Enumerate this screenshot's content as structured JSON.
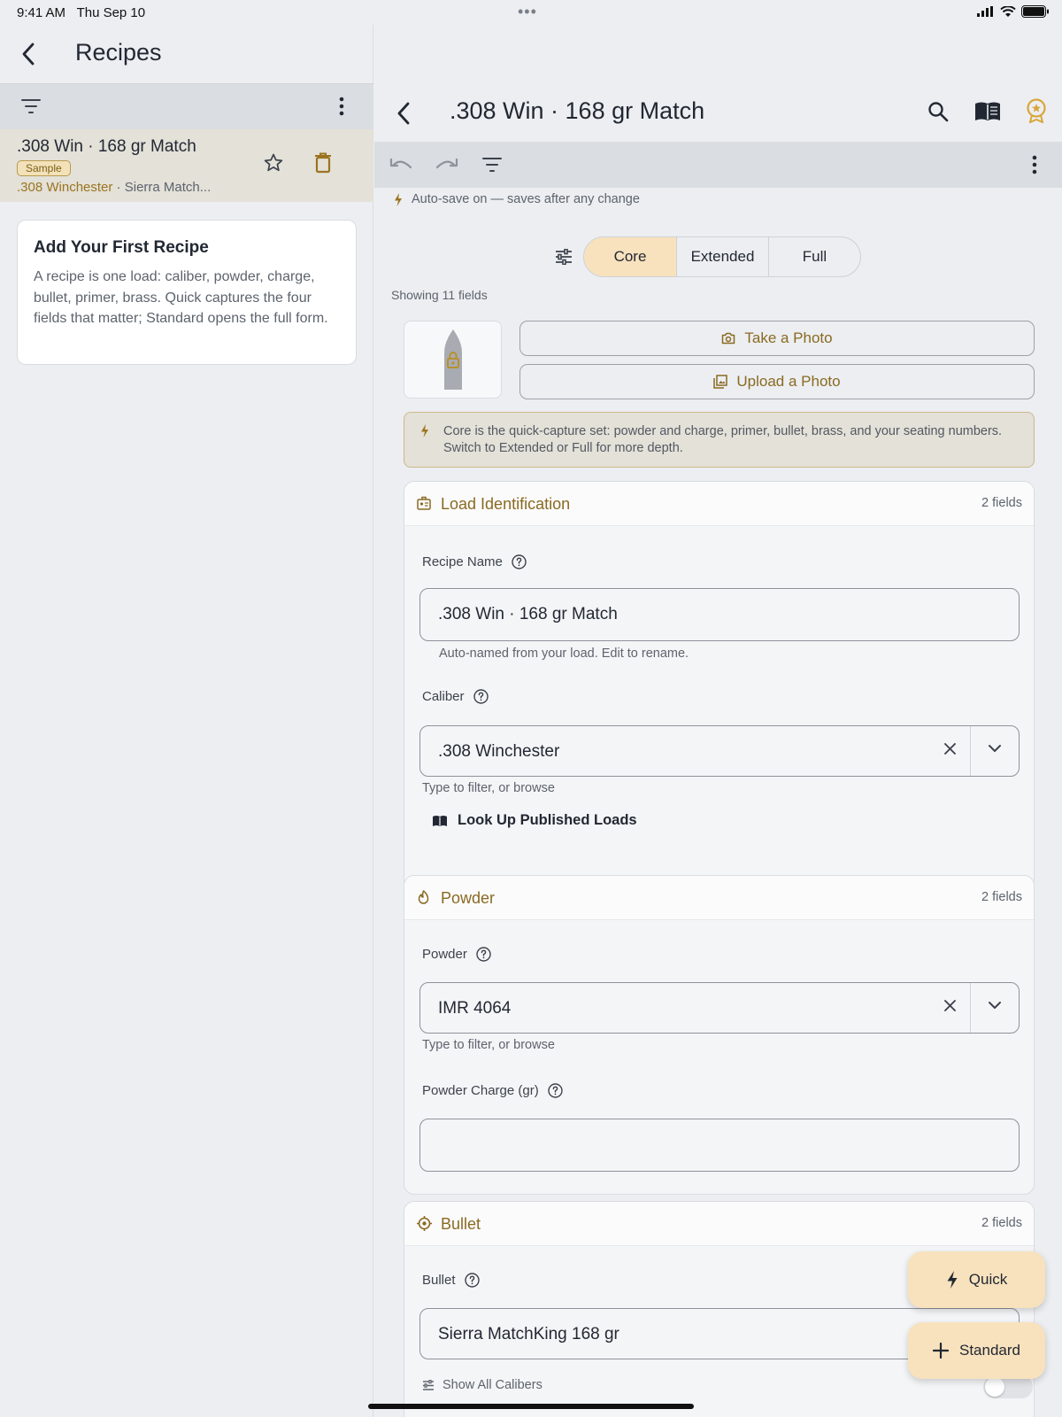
{
  "status_bar": {
    "time": "9:41 AM",
    "date": "Thu Sep 10",
    "dots": "•••"
  },
  "left": {
    "title": "Recipes",
    "recipe": {
      "title": ".308 Win · 168 gr Match",
      "badge": "Sample",
      "caliber": ".308 Winchester",
      "separator": " · ",
      "bullet": "Sierra Match..."
    },
    "add_card": {
      "title": "Add Your First Recipe",
      "body": "A recipe is one load: caliber, powder, charge, bullet, primer, brass. Quick captures the four fields that matter; Standard opens the full form."
    }
  },
  "detail": {
    "title": ".308 Win · 168 gr Match",
    "autosave": "Auto-save on — saves after any change",
    "modes": [
      "Core",
      "Extended",
      "Full"
    ],
    "active_mode": "Core",
    "showing": "Showing 11 fields",
    "take_photo": "Take a Photo",
    "upload_photo": "Upload a Photo",
    "info": "Core is the quick-capture set: powder and charge, primer, bullet, brass, and your seating numbers. Switch to Extended or Full for more depth.",
    "sections": {
      "load_id": {
        "title": "Load Identification",
        "count": "2 fields",
        "recipe_name_label": "Recipe Name",
        "recipe_name_value": ".308 Win · 168 gr Match",
        "recipe_name_helper": "Auto-named from your load. Edit to rename.",
        "caliber_label": "Caliber",
        "caliber_value": ".308 Winchester",
        "caliber_helper": "Type to filter, or browse",
        "lookup": "Look Up Published Loads"
      },
      "powder": {
        "title": "Powder",
        "count": "2 fields",
        "powder_label": "Powder",
        "powder_value": "IMR 4064",
        "powder_helper": "Type to filter, or browse",
        "charge_label": "Powder Charge (gr)",
        "charge_value": ""
      },
      "bullet": {
        "title": "Bullet",
        "count": "2 fields",
        "bullet_label": "Bullet",
        "bullet_value": "Sierra MatchKing 168 gr",
        "show_all": "Show All Calibers"
      }
    }
  },
  "fabs": {
    "quick": "Quick",
    "standard": "Standard"
  },
  "colors": {
    "accent": "#8A6A22",
    "accent_fill": "#F8E2BD",
    "background": "#ECEEF1",
    "badge_fill": "#F3E2B9"
  }
}
